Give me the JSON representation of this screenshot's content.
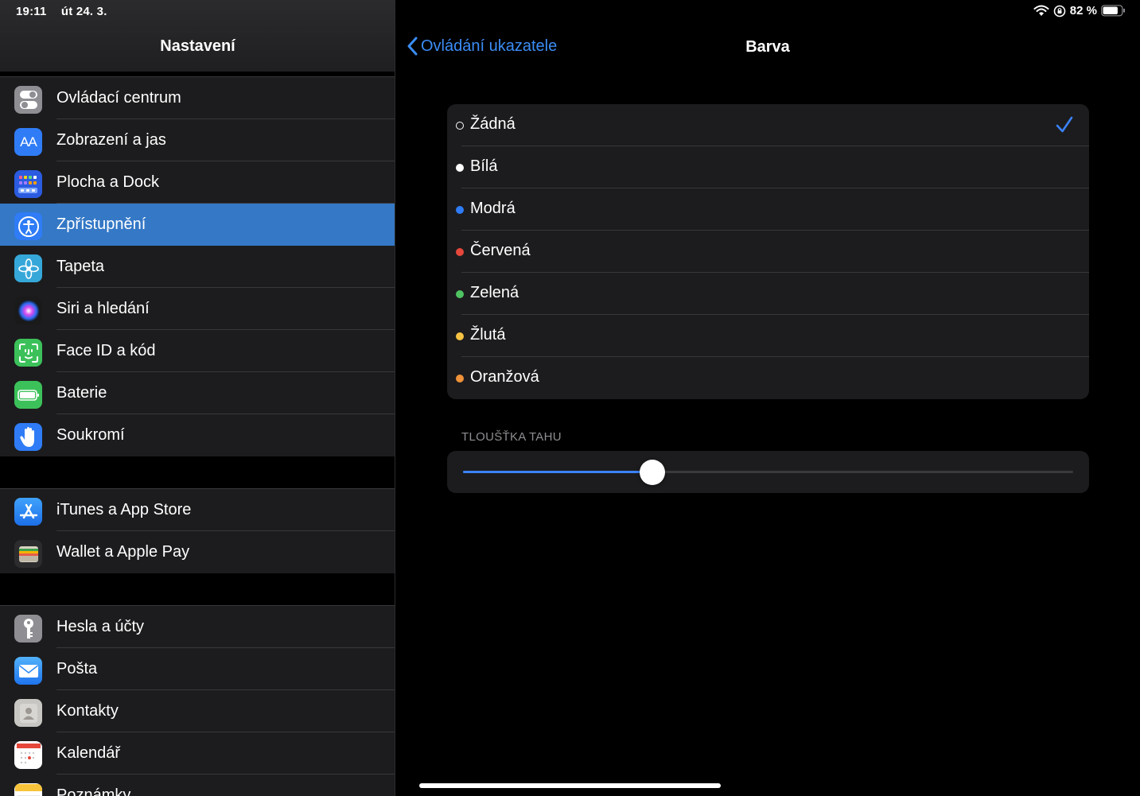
{
  "status_bar": {
    "time": "19:11",
    "date": "út 24. 3.",
    "battery_text": "82 %",
    "battery_level": 0.82
  },
  "sidebar": {
    "title": "Nastavení",
    "groups": [
      [
        {
          "label": "Ovládací centrum",
          "icon": "toggle-switches-icon",
          "color": "#8e8e93"
        },
        {
          "label": "Zobrazení a jas",
          "icon": "text-size-icon",
          "color": "#2f7cf6",
          "icon_text": "AA"
        },
        {
          "label": "Plocha a Dock",
          "icon": "app-grid-icon",
          "color": "#2b5be0"
        },
        {
          "label": "Zpřístupnění",
          "icon": "accessibility-icon",
          "color": "#2f7cf6",
          "active": true
        },
        {
          "label": "Tapeta",
          "icon": "flower-icon",
          "color": "#36a7d9"
        },
        {
          "label": "Siri a hledání",
          "icon": "siri-icon",
          "color": "#222"
        },
        {
          "label": "Face ID a kód",
          "icon": "face-id-icon",
          "color": "#3cc15a"
        },
        {
          "label": "Baterie",
          "icon": "battery-icon",
          "color": "#3cc15a"
        },
        {
          "label": "Soukromí",
          "icon": "hand-icon",
          "color": "#2f7cf6"
        }
      ],
      [
        {
          "label": "iTunes a App Store",
          "icon": "app-store-icon",
          "color": "#2f8af6"
        },
        {
          "label": "Wallet a Apple Pay",
          "icon": "wallet-icon",
          "color": "#1c1c1e"
        }
      ],
      [
        {
          "label": "Hesla a účty",
          "icon": "key-icon",
          "color": "#8e8e93"
        },
        {
          "label": "Pošta",
          "icon": "mail-icon",
          "color": "#2f8af6"
        },
        {
          "label": "Kontakty",
          "icon": "contacts-icon",
          "color": "#b0b0b0"
        },
        {
          "label": "Kalendář",
          "icon": "calendar-icon",
          "color": "#ffffff"
        },
        {
          "label": "Poznámky",
          "icon": "notes-icon",
          "color": "#ffffff"
        }
      ]
    ]
  },
  "detail": {
    "back_label": "Ovládání ukazatele",
    "title": "Barva",
    "options": [
      {
        "label": "Žádná",
        "color": "none",
        "selected": true
      },
      {
        "label": "Bílá",
        "color": "#ffffff"
      },
      {
        "label": "Modrá",
        "color": "#2f7cf6"
      },
      {
        "label": "Červená",
        "color": "#e5483b"
      },
      {
        "label": "Zelená",
        "color": "#4fc361"
      },
      {
        "label": "Žlutá",
        "color": "#f5c242"
      },
      {
        "label": "Oranžová",
        "color": "#f0923a"
      }
    ],
    "stroke_section_header": "TLOUŠŤKA TAHU",
    "stroke_value": 0.31
  }
}
